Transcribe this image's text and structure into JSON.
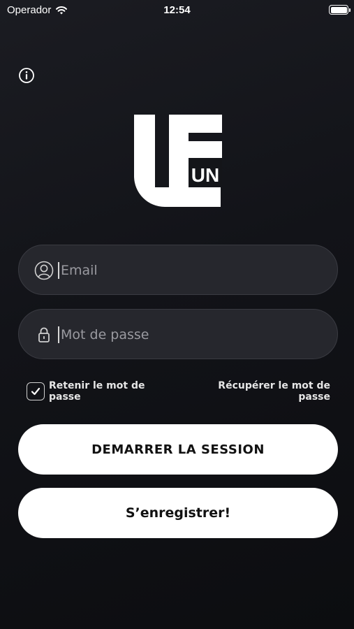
{
  "status_bar": {
    "carrier": "Operador",
    "time": "12:54"
  },
  "icons": {
    "info": "info-icon",
    "wifi": "wifi-icon",
    "battery": "battery-icon",
    "user": "user-icon",
    "lock": "lock-icon",
    "check": "checkmark-icon"
  },
  "logo": {
    "text": "UN"
  },
  "form": {
    "email_placeholder": "Email",
    "email_value": "",
    "password_placeholder": "Mot de passe",
    "password_value": "",
    "remember_label": "Retenir le mot de passe",
    "remember_checked": true,
    "recover_label": "Récupérer le mot de passe"
  },
  "buttons": {
    "start_session": "DEMARRER LA SESSION",
    "register": "S’enregistrer!"
  },
  "colors": {
    "background": "#121318",
    "field_bg": "#26272d",
    "button_bg": "#ffffff",
    "button_text": "#111111"
  }
}
